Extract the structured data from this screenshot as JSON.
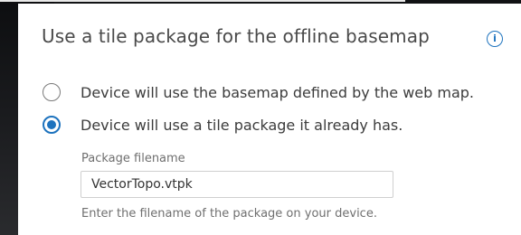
{
  "panel": {
    "title": "Use a tile package for the offline basemap",
    "info_icon": "info-icon"
  },
  "options": [
    {
      "label": "Device will use the basemap defined by the web map.",
      "checked": false
    },
    {
      "label": "Device will use a tile package it already has.",
      "checked": true
    }
  ],
  "package_field": {
    "label": "Package filename",
    "value": "VectorTopo.vtpk",
    "helper": "Enter the filename of the package on your device."
  },
  "colors": {
    "accent": "#1e73be",
    "text": "#4a4a4a",
    "muted": "#6f6f6f"
  }
}
